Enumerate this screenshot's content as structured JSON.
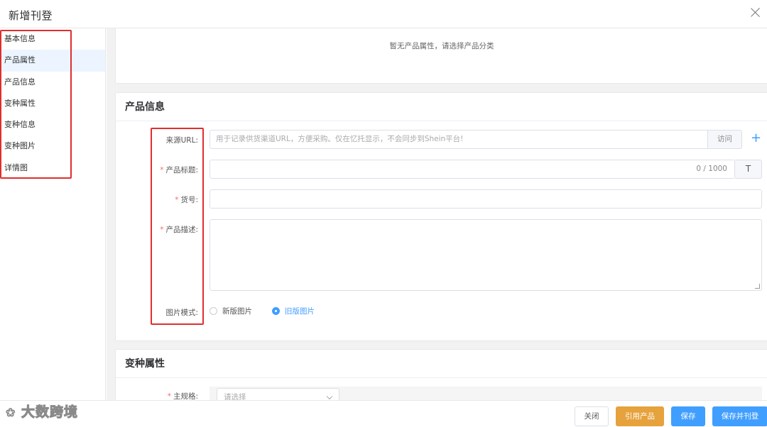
{
  "dialog": {
    "title": "新增刊登"
  },
  "sidebar": {
    "items": [
      {
        "label": "基本信息"
      },
      {
        "label": "产品属性"
      },
      {
        "label": "产品信息"
      },
      {
        "label": "变种属性"
      },
      {
        "label": "变种信息"
      },
      {
        "label": "变种图片"
      },
      {
        "label": "详情图"
      }
    ],
    "active_item": "产品属性"
  },
  "product_attributes": {
    "empty_text": "暂无产品属性，请选择产品分类"
  },
  "product_info": {
    "title": "产品信息",
    "source_url": {
      "label": "来源URL:",
      "placeholder": "用于记录供货渠道URL，方便采购。仅在忆托显示，不会同步到Shein平台!",
      "visit_label": "访问",
      "add_icon": "+"
    },
    "product_title": {
      "label": "产品标题:",
      "counter": "0 / 1000",
      "format_icon": "T"
    },
    "sku": {
      "label": "货号:"
    },
    "description": {
      "label": "产品描述:"
    },
    "image_mode": {
      "label": "图片模式:",
      "options": [
        "新版图片",
        "旧版图片"
      ],
      "selected": "旧版图片"
    }
  },
  "variant_attributes": {
    "title": "变种属性",
    "main_spec": {
      "label": "主规格:",
      "placeholder": "请选择"
    }
  },
  "footer": {
    "close_label": "关闭",
    "reference_label": "引用产品",
    "save_label": "保存",
    "save_publish_label": "保存并刊登"
  },
  "watermark": {
    "text": "大数跨境"
  },
  "colors": {
    "primary": "#409eff",
    "warning": "#e6a23c",
    "required": "#f56c6c",
    "annotation_red": "#e02e2e"
  }
}
